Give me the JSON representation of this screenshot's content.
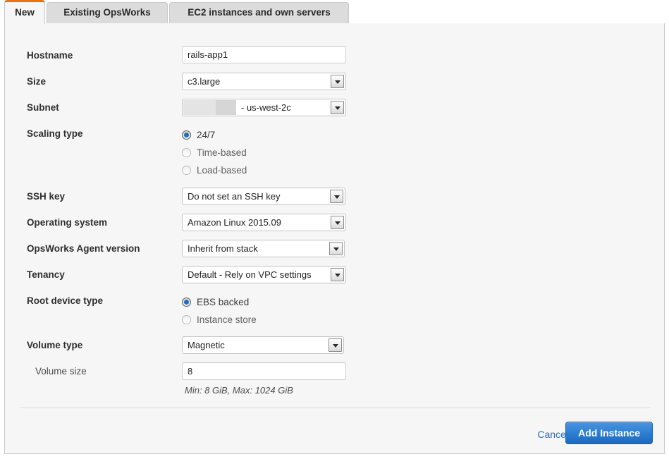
{
  "tabs": [
    {
      "label": "New",
      "active": true
    },
    {
      "label": "Existing OpsWorks",
      "active": false
    },
    {
      "label": "EC2 instances and own servers",
      "active": false
    }
  ],
  "form": {
    "hostname": {
      "label": "Hostname",
      "value": "rails-app1"
    },
    "size": {
      "label": "Size",
      "value": "c3.large"
    },
    "subnet": {
      "label": "Subnet",
      "value": "- us-west-2c",
      "redacted": true
    },
    "scaling_type": {
      "label": "Scaling type",
      "options": [
        {
          "label": "24/7",
          "selected": true,
          "disabled": false
        },
        {
          "label": "Time-based",
          "selected": false,
          "disabled": true
        },
        {
          "label": "Load-based",
          "selected": false,
          "disabled": true
        }
      ]
    },
    "ssh_key": {
      "label": "SSH key",
      "value": "Do not set an SSH key"
    },
    "operating_system": {
      "label": "Operating system",
      "value": "Amazon Linux 2015.09"
    },
    "agent_version": {
      "label": "OpsWorks Agent version",
      "value": "Inherit from stack"
    },
    "tenancy": {
      "label": "Tenancy",
      "value": "Default - Rely on VPC settings"
    },
    "root_device_type": {
      "label": "Root device type",
      "options": [
        {
          "label": "EBS backed",
          "selected": true,
          "disabled": false
        },
        {
          "label": "Instance store",
          "selected": false,
          "disabled": true
        }
      ]
    },
    "volume_type": {
      "label": "Volume type",
      "value": "Magnetic"
    },
    "volume_size": {
      "label": "Volume size",
      "value": "8",
      "hint": "Min: 8 GiB, Max: 1024 GiB"
    }
  },
  "footer": {
    "cancel_label": "Cancel",
    "submit_label": "Add Instance"
  },
  "colors": {
    "active_tab_accent": "#ec7211",
    "primary_button": "#2d7fd2",
    "link": "#1f6fc4",
    "radio_selected": "#1b6ec2",
    "panel_background": "#f6f6f6"
  }
}
